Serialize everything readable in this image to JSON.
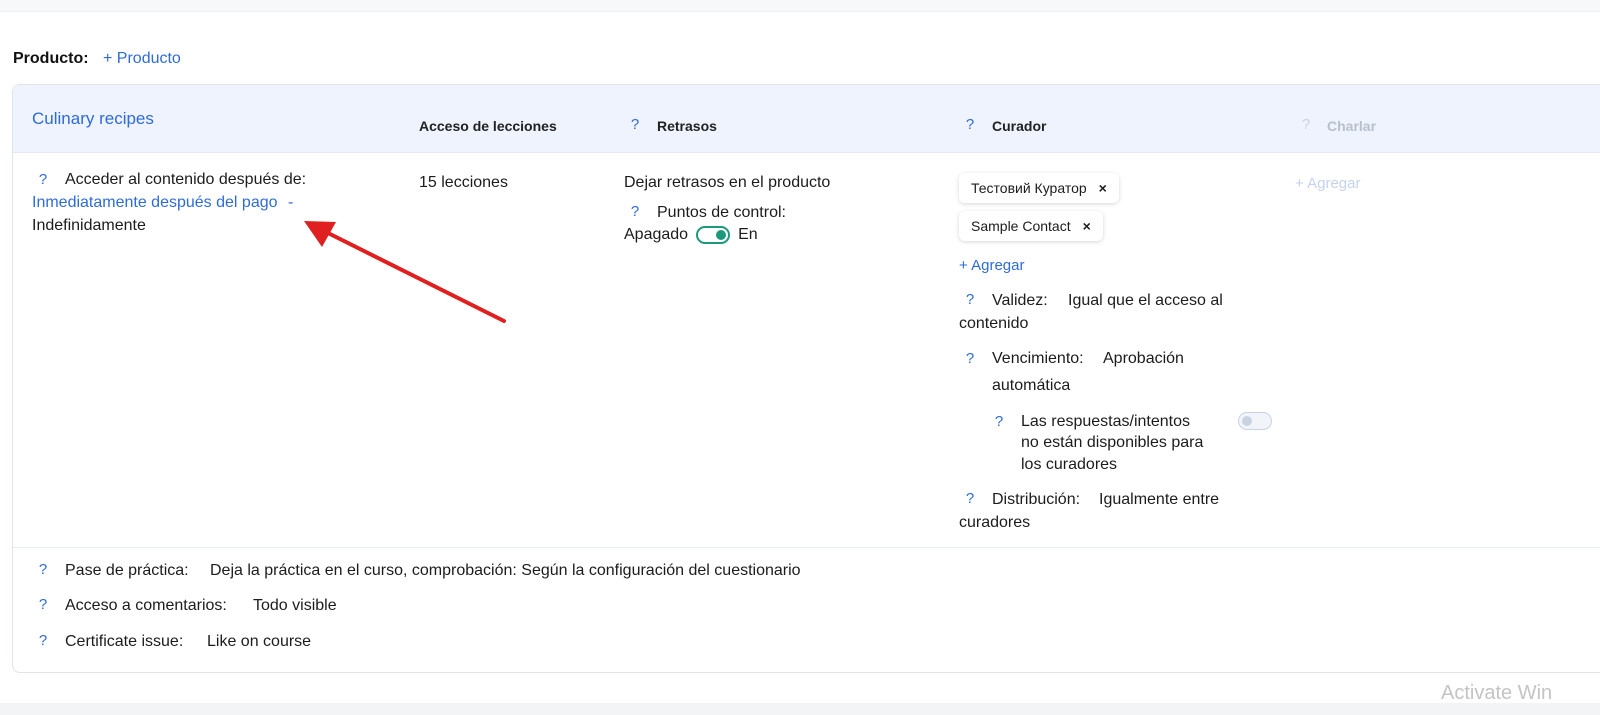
{
  "producto": {
    "label": "Producto:",
    "add_link": "+ Producto"
  },
  "card": {
    "course_title": "Culinary recipes",
    "columns": {
      "access": "Acceso de lecciones",
      "delays": "Retrasos",
      "curator": "Curador",
      "chat": "Charlar"
    },
    "access_content": {
      "label": "Acceder al contenido después de:",
      "value_start": "Inmediatamente después del pago",
      "separator": "-",
      "value_end": "Indefinidamente"
    },
    "lessons_link": "15 lecciones",
    "delays": {
      "link": "Dejar retrasos en el producto",
      "checkpoints_label": "Puntos de control:",
      "toggle_off_label": "Apagado",
      "toggle_on_label": "En",
      "toggle_state": "on"
    },
    "curators": {
      "chips": [
        "Тестовий Куратор",
        "Sample Contact"
      ],
      "add_link": "+ Agregar",
      "validity_label": "Validez:",
      "validity_value_1": "Igual que el acceso al",
      "validity_value_2": "contenido",
      "expiry_label": "Vencimiento:",
      "expiry_value_1": "Aprobación",
      "expiry_value_2": "automática",
      "answers_line_1": "Las respuestas/intentos",
      "answers_line_2": "no están disponibles para",
      "answers_line_3": "los curadores",
      "answers_toggle_state": "off",
      "distribution_label": "Distribución:",
      "distribution_value_1": "Igualmente entre",
      "distribution_value_2": "curadores"
    },
    "chat_add": "+ Agregar",
    "practice": {
      "label": "Pase de práctica:",
      "value": "Deja la práctica en el curso, comprobación: Según la configuración del cuestionario"
    },
    "comments": {
      "label": "Acceso a comentarios:",
      "value": "Todo visible"
    },
    "certificate": {
      "label": "Certificate issue:",
      "value": "Like on course"
    }
  },
  "help_glyph": "?",
  "remove_glyph": "×",
  "watermark": "Activate Win",
  "colors": {
    "link": "#2f6bd8",
    "toggle_on": "#1a9a7a",
    "header_bg": "#eef3fd",
    "annotation_arrow": "#e02020"
  }
}
